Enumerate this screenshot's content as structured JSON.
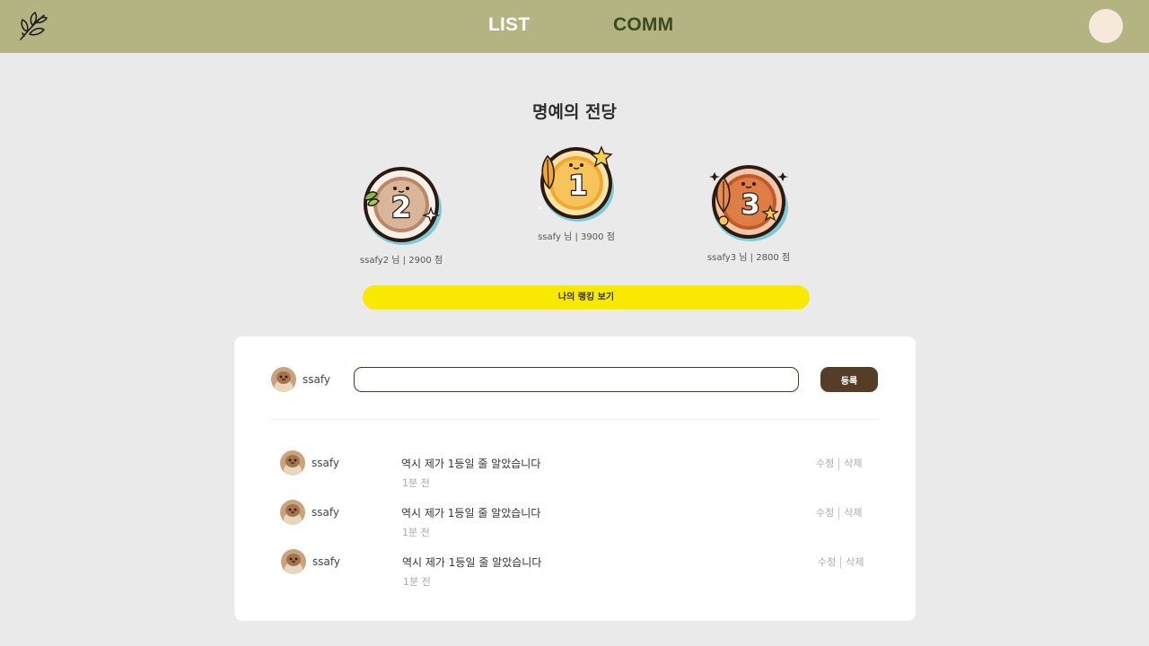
{
  "nav": {
    "tabs": [
      {
        "label": "LIST"
      },
      {
        "label": "COMM"
      }
    ],
    "colors": {
      "bar": "#b4b483",
      "active": "#ffffff",
      "inactive": "#3c4a1f",
      "avatar": "#f6e9dc"
    }
  },
  "hall": {
    "title": "명예의 전당",
    "ranks": [
      {
        "place": "1",
        "user": "ssafy",
        "honorific": "님",
        "sep": "|",
        "score": "3900",
        "unit": "점",
        "color": "#f0a830"
      },
      {
        "place": "2",
        "user": "ssafy2",
        "honorific": "님",
        "sep": "|",
        "score": "2900",
        "unit": "점",
        "color": "#b07a55"
      },
      {
        "place": "3",
        "user": "ssafy3",
        "honorific": "님",
        "sep": "|",
        "score": "2800",
        "unit": "점",
        "color": "#c2592a"
      }
    ],
    "my_rank_button": "나의 랭킹 보기"
  },
  "composer": {
    "user": "ssafy",
    "input_value": "",
    "input_placeholder": "",
    "submit_label": "등록"
  },
  "comments": [
    {
      "user": "ssafy",
      "text": "역시 제가 1등일 줄 알았습니다",
      "time": "1분 전",
      "edit": "수정",
      "delete": "삭제"
    },
    {
      "user": "ssafy",
      "text": "역시 제가 1등일 줄 알았습니다",
      "time": "1분 전",
      "edit": "수정",
      "delete": "삭제"
    },
    {
      "user": "ssafy",
      "text": "역시 제가 1등일 줄 알았습니다",
      "time": "1분 전",
      "edit": "수정",
      "delete": "삭제"
    }
  ]
}
